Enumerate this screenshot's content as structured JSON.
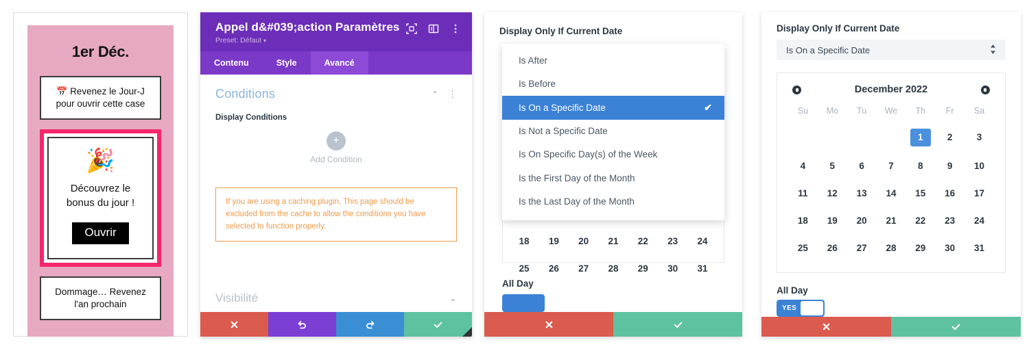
{
  "panel1": {
    "title": "1er Déc.",
    "box_locked": {
      "emoji": "📅",
      "text": "Revenez le Jour-J pour ouvrir cette case"
    },
    "box_active": {
      "emoji": "🎉",
      "text": "Découvrez le bonus du jour !",
      "button": "Ouvrir"
    },
    "box_expired": {
      "text": "Dommage… Revenez l'an prochain"
    },
    "colors": {
      "card_bg": "#e6a9c1",
      "highlight_border": "#f5266c",
      "button_bg": "#000000"
    }
  },
  "panel2": {
    "header": {
      "title": "Appel d&#039;action Paramètres",
      "preset": "Preset: Défaut",
      "preset_caret": "▾"
    },
    "tabs": [
      {
        "label": "Contenu",
        "active": false
      },
      {
        "label": "Style",
        "active": false
      },
      {
        "label": "Avancé",
        "active": true
      }
    ],
    "section": {
      "title": "Conditions",
      "collapse_caret": "⌃",
      "kebab": "⋮"
    },
    "field_label": "Display Conditions",
    "add_condition": {
      "plus": "+",
      "label": "Add Condition"
    },
    "notice": "If you are using a caching plugin, This page should be excluded from the cache to allow the conditions you have selected to function properly.",
    "visibilite": {
      "title": "Visibilité",
      "caret": "⌄"
    },
    "footer": [
      {
        "name": "cancel",
        "glyph": "✖",
        "color": "#db5b4e"
      },
      {
        "name": "undo",
        "glyph": "↺",
        "color": "#7b3fd4"
      },
      {
        "name": "redo",
        "glyph": "↻",
        "color": "#3a8fd4"
      },
      {
        "name": "save",
        "glyph": "✔",
        "color": "#5ec2a0"
      }
    ],
    "colors": {
      "header_bg": "#6c2eb9",
      "tabbar_bg": "#7b39c7",
      "tab_active_bg": "#8c4ad6"
    }
  },
  "panel3": {
    "label": "Display Only If Current Date",
    "dropdown_options": [
      {
        "label": "Is After",
        "selected": false
      },
      {
        "label": "Is Before",
        "selected": false
      },
      {
        "label": "Is On a Specific Date",
        "selected": true
      },
      {
        "label": "Is Not a Specific Date",
        "selected": false
      },
      {
        "label": "Is On Specific Day(s) of the Week",
        "selected": false
      },
      {
        "label": "Is the First Day of the Month",
        "selected": false
      },
      {
        "label": "Is the Last Day of the Month",
        "selected": false
      }
    ],
    "check_glyph": "✔",
    "visible_date_rows": [
      [
        "18",
        "19",
        "20",
        "21",
        "22",
        "23",
        "24"
      ],
      [
        "25",
        "26",
        "27",
        "28",
        "29",
        "30",
        "31"
      ]
    ],
    "all_day_label": "All Day",
    "footer": [
      {
        "name": "cancel",
        "glyph": "✖",
        "color": "#db5b4e"
      },
      {
        "name": "save",
        "glyph": "✔",
        "color": "#5ec2a0"
      }
    ],
    "colors": {
      "highlight": "#3b82d6"
    }
  },
  "panel4": {
    "label": "Display Only If Current Date",
    "select_value": "Is On a Specific Date",
    "select_arrows": "⇕",
    "calendar": {
      "month_year": "December 2022",
      "prev_label": "prev-month",
      "next_label": "next-month",
      "weekdays": [
        "Su",
        "Mo",
        "Tu",
        "We",
        "Th",
        "Fr",
        "Sa"
      ],
      "weeks": [
        [
          "",
          "",
          "",
          "",
          "1",
          "2",
          "3"
        ],
        [
          "4",
          "5",
          "6",
          "7",
          "8",
          "9",
          "10"
        ],
        [
          "11",
          "12",
          "13",
          "14",
          "15",
          "16",
          "17"
        ],
        [
          "18",
          "19",
          "20",
          "21",
          "22",
          "23",
          "24"
        ],
        [
          "25",
          "26",
          "27",
          "28",
          "29",
          "30",
          "31"
        ]
      ],
      "selected_day": "1"
    },
    "all_day_label": "All Day",
    "toggle_value": "YES",
    "footer": [
      {
        "name": "cancel",
        "glyph": "✖",
        "color": "#db5b4e"
      },
      {
        "name": "save",
        "glyph": "✔",
        "color": "#5ec2a0"
      }
    ],
    "colors": {
      "selected_day_bg": "#4a90dd",
      "toggle_on": "#3b82d6"
    }
  }
}
